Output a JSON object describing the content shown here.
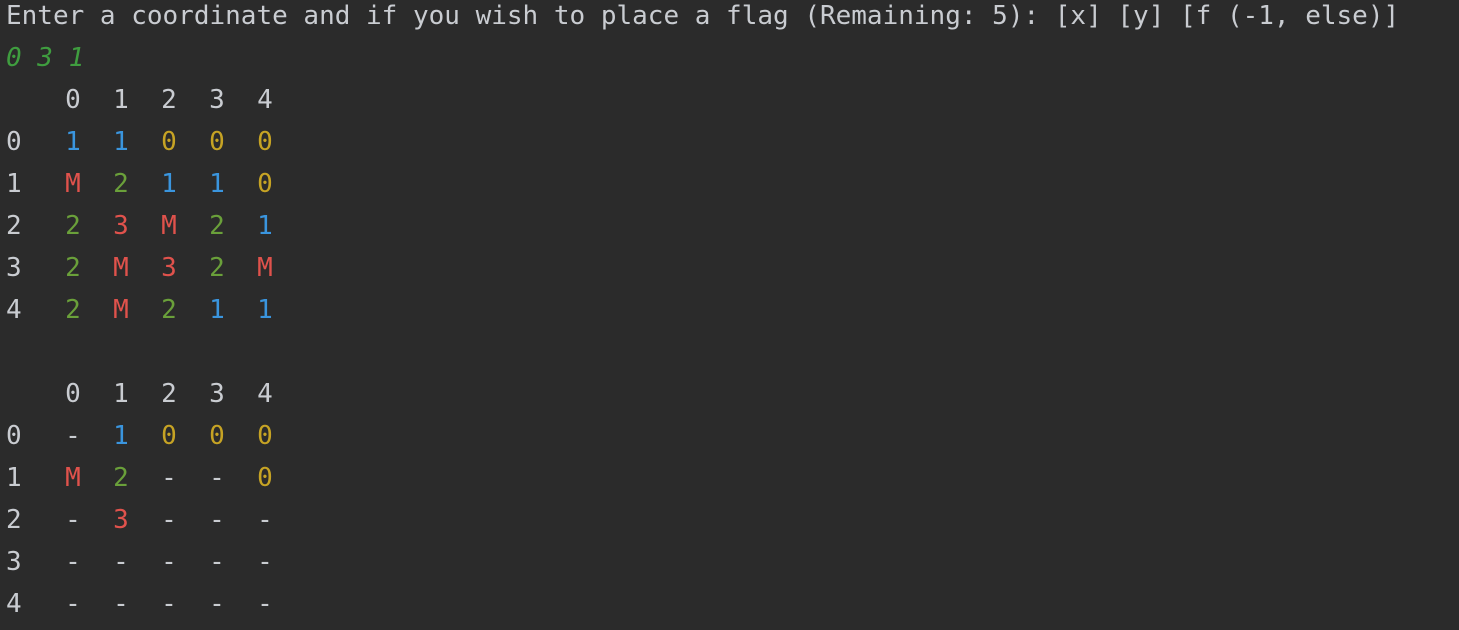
{
  "prompt": "Enter a coordinate and if you wish to place a flag (Remaining: 5): [x] [y] [f (-1, else)]",
  "user_input": "0 3 1",
  "colors": {
    "background": "#2b2b2b",
    "text": "#c9ccd1",
    "input": "#3f9d3f",
    "one": "#3a95de",
    "zero": "#c6a324",
    "mine_or_three": "#e0524c",
    "two": "#6aa03a"
  },
  "boards": [
    {
      "name": "solution-board",
      "header": [
        "0",
        "1",
        "2",
        "3",
        "4"
      ],
      "rows": [
        {
          "label": "0",
          "cells": [
            "1",
            "1",
            "0",
            "0",
            "0"
          ]
        },
        {
          "label": "1",
          "cells": [
            "M",
            "2",
            "1",
            "1",
            "0"
          ]
        },
        {
          "label": "2",
          "cells": [
            "2",
            "3",
            "M",
            "2",
            "1"
          ]
        },
        {
          "label": "3",
          "cells": [
            "2",
            "M",
            "3",
            "2",
            "M"
          ]
        },
        {
          "label": "4",
          "cells": [
            "2",
            "M",
            "2",
            "1",
            "1"
          ]
        }
      ]
    },
    {
      "name": "player-board",
      "header": [
        "0",
        "1",
        "2",
        "3",
        "4"
      ],
      "rows": [
        {
          "label": "0",
          "cells": [
            "-",
            "1",
            "0",
            "0",
            "0"
          ]
        },
        {
          "label": "1",
          "cells": [
            "M",
            "2",
            "-",
            "-",
            "0"
          ]
        },
        {
          "label": "2",
          "cells": [
            "-",
            "3",
            "-",
            "-",
            "-"
          ]
        },
        {
          "label": "3",
          "cells": [
            "-",
            "-",
            "-",
            "-",
            "-"
          ]
        },
        {
          "label": "4",
          "cells": [
            "-",
            "-",
            "-",
            "-",
            "-"
          ]
        }
      ]
    }
  ]
}
